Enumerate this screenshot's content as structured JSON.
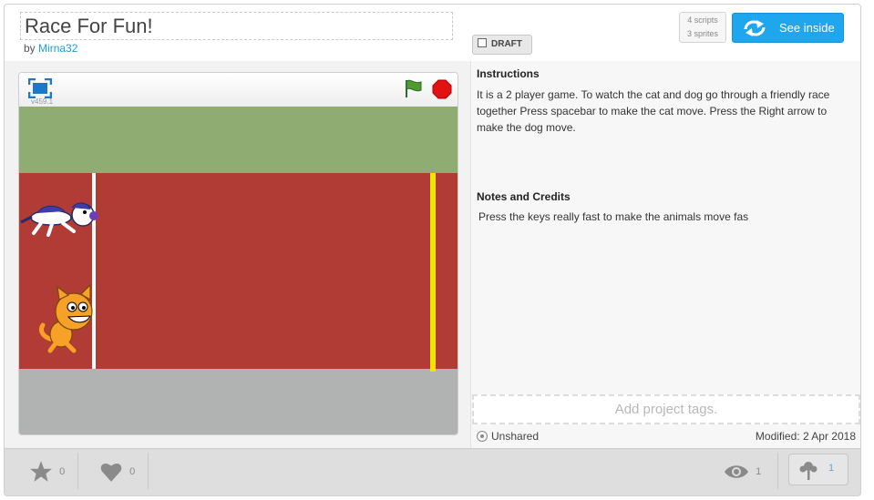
{
  "project": {
    "title": "Race For Fun!",
    "by_label": "by",
    "author": "Mirna32"
  },
  "draft": {
    "label": "DRAFT",
    "checked": false
  },
  "stats": {
    "scripts": "4 scripts",
    "sprites": "3 sprites"
  },
  "see_inside": {
    "label": "See inside",
    "icon": "remix-arrows-icon"
  },
  "player": {
    "version": "v459.1",
    "icons": {
      "fullscreen": "fullscreen-icon",
      "green_flag": "green-flag-icon",
      "stop": "stop-sign-icon"
    }
  },
  "instructions": {
    "heading": "Instructions",
    "text": "It is a 2 player game. To watch the cat and dog go through a friendly race together Press spacebar to make the cat move. Press the Right arrow to make the dog move."
  },
  "notes": {
    "heading": "Notes and Credits",
    "text": "Press the keys really fast to make the animals move fas"
  },
  "tags": {
    "placeholder": "Add project tags."
  },
  "status": {
    "sharing": "Unshared",
    "modified": "Modified: 2 Apr 2018"
  },
  "footer": {
    "favorites": "0",
    "loves": "0",
    "views": "1",
    "remixes": "1"
  },
  "colors": {
    "accent": "#1ea7ef",
    "grass": "#8fac72",
    "track": "#b03c35",
    "finish_line": "#f2e600",
    "ground": "#b1b3b2"
  }
}
